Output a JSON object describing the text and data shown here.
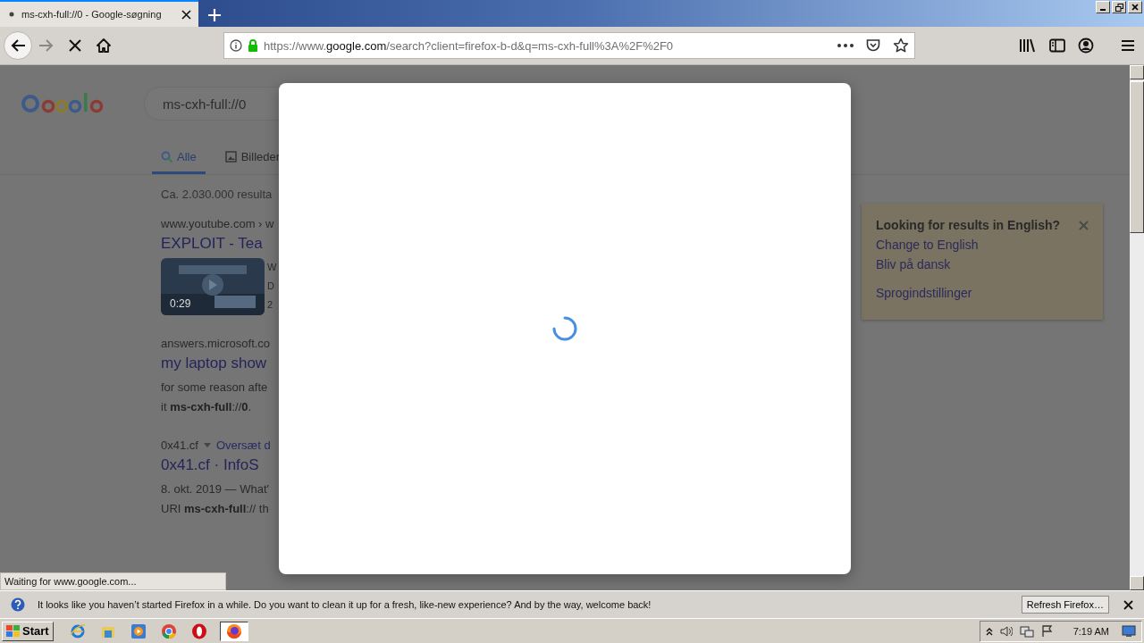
{
  "browser": {
    "tabs": [
      {
        "title": "ms-cxh-full://0 - Google-søgning",
        "selected": true
      }
    ],
    "url": {
      "prefix": "https://www.",
      "domain": "google.com",
      "path": "/search?client=firefox-b-d&q=ms-cxh-full%3A%2F%2F0"
    },
    "status": "Waiting for www.google.com..."
  },
  "page": {
    "search_query": "ms-cxh-full://0",
    "tabs": [
      {
        "label": "Alle",
        "selected": true
      },
      {
        "label": "Billeder",
        "selected": false
      }
    ],
    "result_count": "Ca. 2.030.000 resulta",
    "results": [
      {
        "cite": "www.youtube.com › w",
        "title": "EXPLOIT - Tea",
        "video_duration": "0:29",
        "snippet": [
          "W",
          "D",
          "2"
        ]
      },
      {
        "cite": "answers.microsoft.co",
        "title": "my laptop show",
        "snippet": [
          "for some reason afte",
          "it **ms-cxh-full**://**0**."
        ]
      },
      {
        "cite": "0x41.cf",
        "translate": "Oversæt d",
        "title": "0x41.cf · InfoS",
        "snippet": [
          "8. okt. 2019 — What'",
          "URI **ms-cxh-full**:// th"
        ]
      }
    ],
    "language_card": {
      "heading": "Looking for results in English?",
      "links": [
        "Change to English",
        "Bliv på dansk"
      ],
      "settings": "Sprogindstillinger"
    }
  },
  "notification": {
    "message": "It looks like you haven’t started Firefox in a while. Do you want to clean it up for a fresh, like-new experience? And by the way, welcome back!",
    "button": "Refresh Firefox…"
  },
  "taskbar": {
    "start": "Start",
    "apps": [
      {
        "kind": "ie",
        "selected": false
      },
      {
        "kind": "explorer",
        "selected": false
      },
      {
        "kind": "media",
        "selected": false
      },
      {
        "kind": "chrome",
        "selected": false
      },
      {
        "kind": "opera",
        "selected": false
      },
      {
        "kind": "firefox",
        "selected": true
      }
    ],
    "clock": "7:19 AM"
  }
}
